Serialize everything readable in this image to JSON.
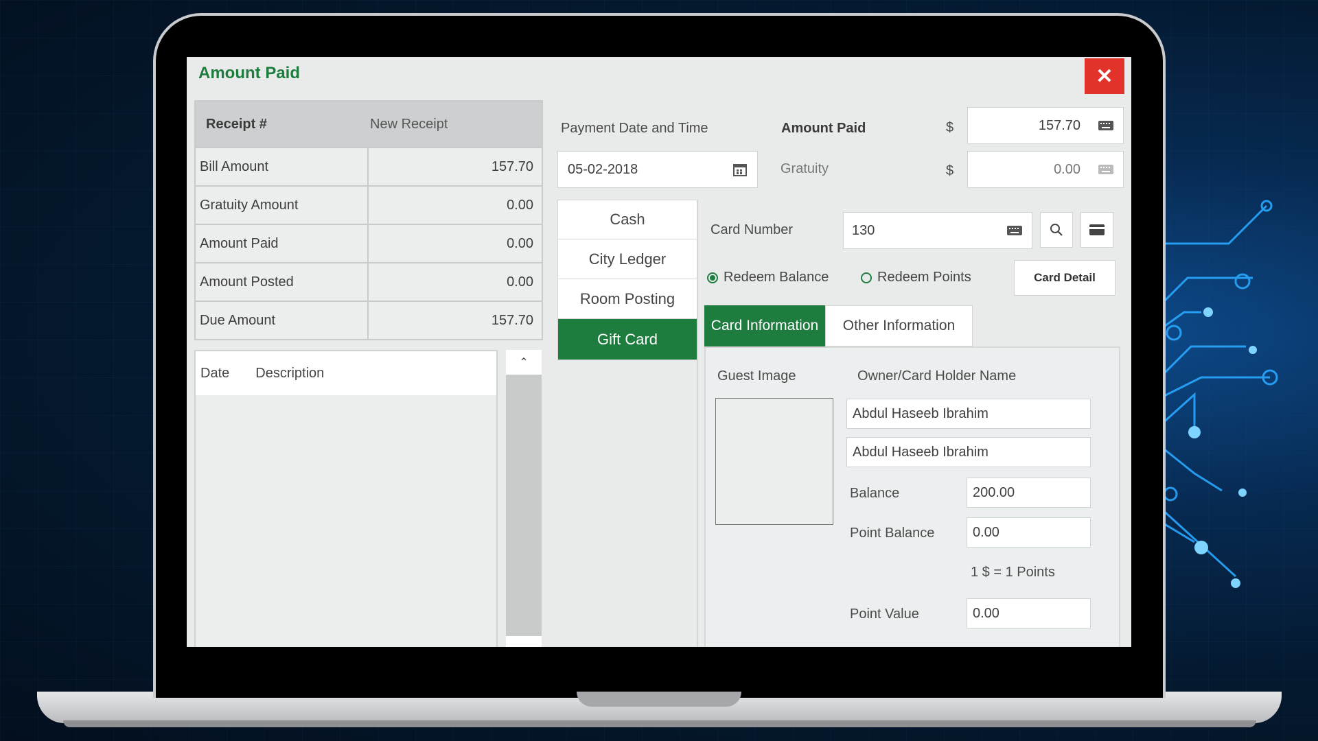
{
  "dialog": {
    "title": "Amount Paid",
    "close_label": "✕"
  },
  "summary": {
    "header_key": "Receipt #",
    "header_value": "New Receipt",
    "rows": [
      {
        "label": "Bill Amount",
        "value": "157.70"
      },
      {
        "label": "Gratuity Amount",
        "value": "0.00"
      },
      {
        "label": "Amount Paid",
        "value": "0.00"
      },
      {
        "label": "Amount Posted",
        "value": "0.00"
      },
      {
        "label": "Due Amount",
        "value": "157.70"
      }
    ]
  },
  "transactions": {
    "columns": [
      "Date",
      "Description"
    ],
    "scroll_up": "⌃",
    "scroll_down": "⌄"
  },
  "payment": {
    "date_label": "Payment Date and Time",
    "date_value": "05-02-2018",
    "amount_paid_label": "Amount Paid",
    "currency": "$",
    "amount_paid_value": "157.70",
    "gratuity_label": "Gratuity",
    "gratuity_value": "0.00"
  },
  "methods": [
    "Cash",
    "City Ledger",
    "Room Posting",
    "Gift Card"
  ],
  "active_method": "Gift Card",
  "gift_card": {
    "card_number_label": "Card Number",
    "card_number_value": "130",
    "redeem_balance_label": "Redeem Balance",
    "redeem_points_label": "Redeem Points",
    "redeem_selected": "balance",
    "card_detail_label": "Card Detail",
    "tabs": [
      "Card Information",
      "Other Information"
    ],
    "active_tab": "Card Information",
    "guest_image_label": "Guest Image",
    "owner_label": "Owner/Card Holder Name",
    "owner_name_1": "Abdul Haseeb Ibrahim",
    "owner_name_2": "Abdul Haseeb Ibrahim",
    "balance_label": "Balance",
    "balance_value": "200.00",
    "point_balance_label": "Point Balance",
    "point_balance_value": "0.00",
    "conversion_text": "1 $ = 1 Points",
    "point_value_label": "Point Value",
    "point_value_value": "0.00"
  },
  "colors": {
    "accent": "#1e7d3e",
    "close": "#e2332b",
    "background": "#e9ebeb"
  }
}
